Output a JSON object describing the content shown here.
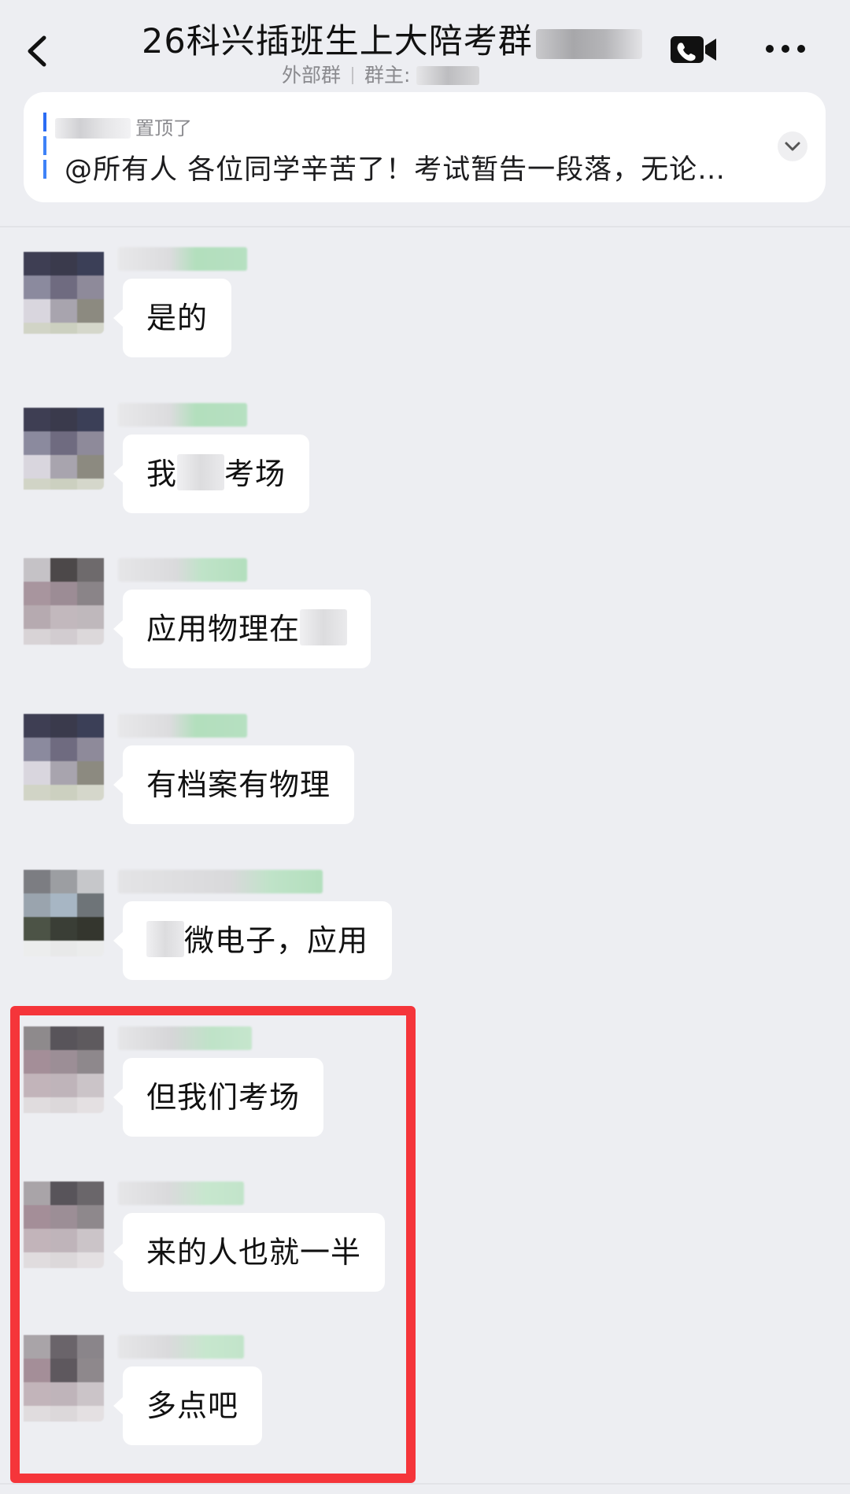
{
  "header": {
    "title": "26科兴插班生上大陪考群",
    "subtitle_type": "外部群",
    "subtitle_owner_label": "群主:"
  },
  "pinned": {
    "meta": "置顶了",
    "text": "@所有人 各位同学辛苦了！考试暂告一段落，无论…"
  },
  "messages": [
    {
      "text_before": "是的",
      "text_after": ""
    },
    {
      "text_before": "我",
      "text_after": "考场"
    },
    {
      "text_before": "应用物理在",
      "text_after": ""
    },
    {
      "text_before": "有档案有物理",
      "text_after": ""
    },
    {
      "text_before": "",
      "text_after": "微电子，应用"
    },
    {
      "text_before": "但我们考场",
      "text_after": ""
    },
    {
      "text_before": "来的人也就一半",
      "text_after": ""
    },
    {
      "text_before": "多点吧",
      "text_after": ""
    }
  ],
  "icons": {
    "back": "chevron-left-icon",
    "call": "video-call-icon",
    "more": "more-icon",
    "expand": "chevron-down-icon"
  },
  "colors": {
    "background": "#EDEEF2",
    "bubble": "#FFFFFF",
    "highlight": "#F5353A",
    "pin_accent": "#3E82F7"
  }
}
